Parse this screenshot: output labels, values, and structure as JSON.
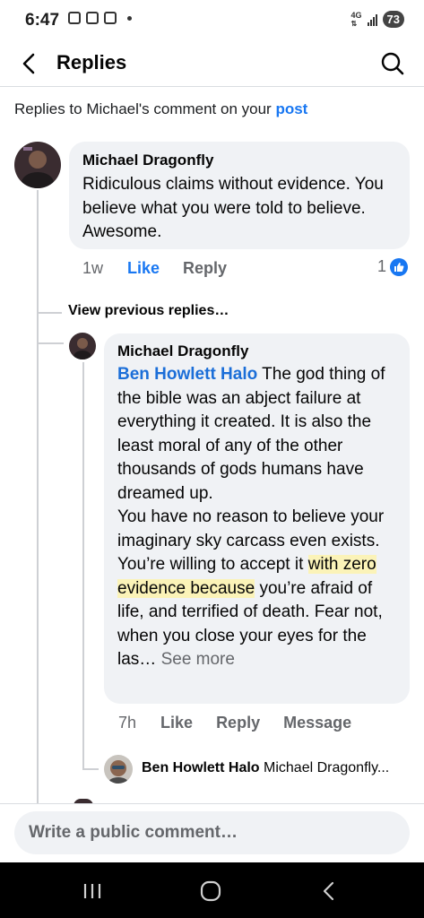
{
  "status": {
    "time": "6:47",
    "network": "4G",
    "battery": "73"
  },
  "header": {
    "title": "Replies"
  },
  "context": {
    "prefix": "Replies to Michael's comment on your ",
    "link": "post"
  },
  "main_comment": {
    "author": "Michael Dragonfly",
    "text": "Ridiculous claims without evidence. You believe what you were told to believe. Awesome.",
    "time": "1w",
    "like_label": "Like",
    "reply_label": "Reply",
    "reaction_count": "1"
  },
  "view_previous": "View previous replies…",
  "reply_comment": {
    "author": "Michael Dragonfly",
    "mention": "Ben Howlett Halo",
    "text_part1": " The god thing of the bible was an abject failure at everything it created. It is also the least moral of any of the other thousands of gods humans have dreamed up.",
    "text_part2": "You have no reason to believe your imaginary sky carcass even exists. You’re willing to accept it ",
    "highlight": "with zero evidence because",
    "text_part3": " you’re afraid of life, and terrified of death. Fear not, when you close your eyes for the las… ",
    "see_more": "See more",
    "time": "7h",
    "like_label": "Like",
    "reply_label": "Reply",
    "message_label": "Message"
  },
  "nested_reply": {
    "author": "Ben Howlett Halo",
    "text": "Michael Dragonfly..."
  },
  "composer": {
    "placeholder": "Write a public comment…"
  },
  "colors": {
    "accent": "#1877f2",
    "bubble": "#f0f2f5",
    "highlight": "#fbf3b8"
  }
}
